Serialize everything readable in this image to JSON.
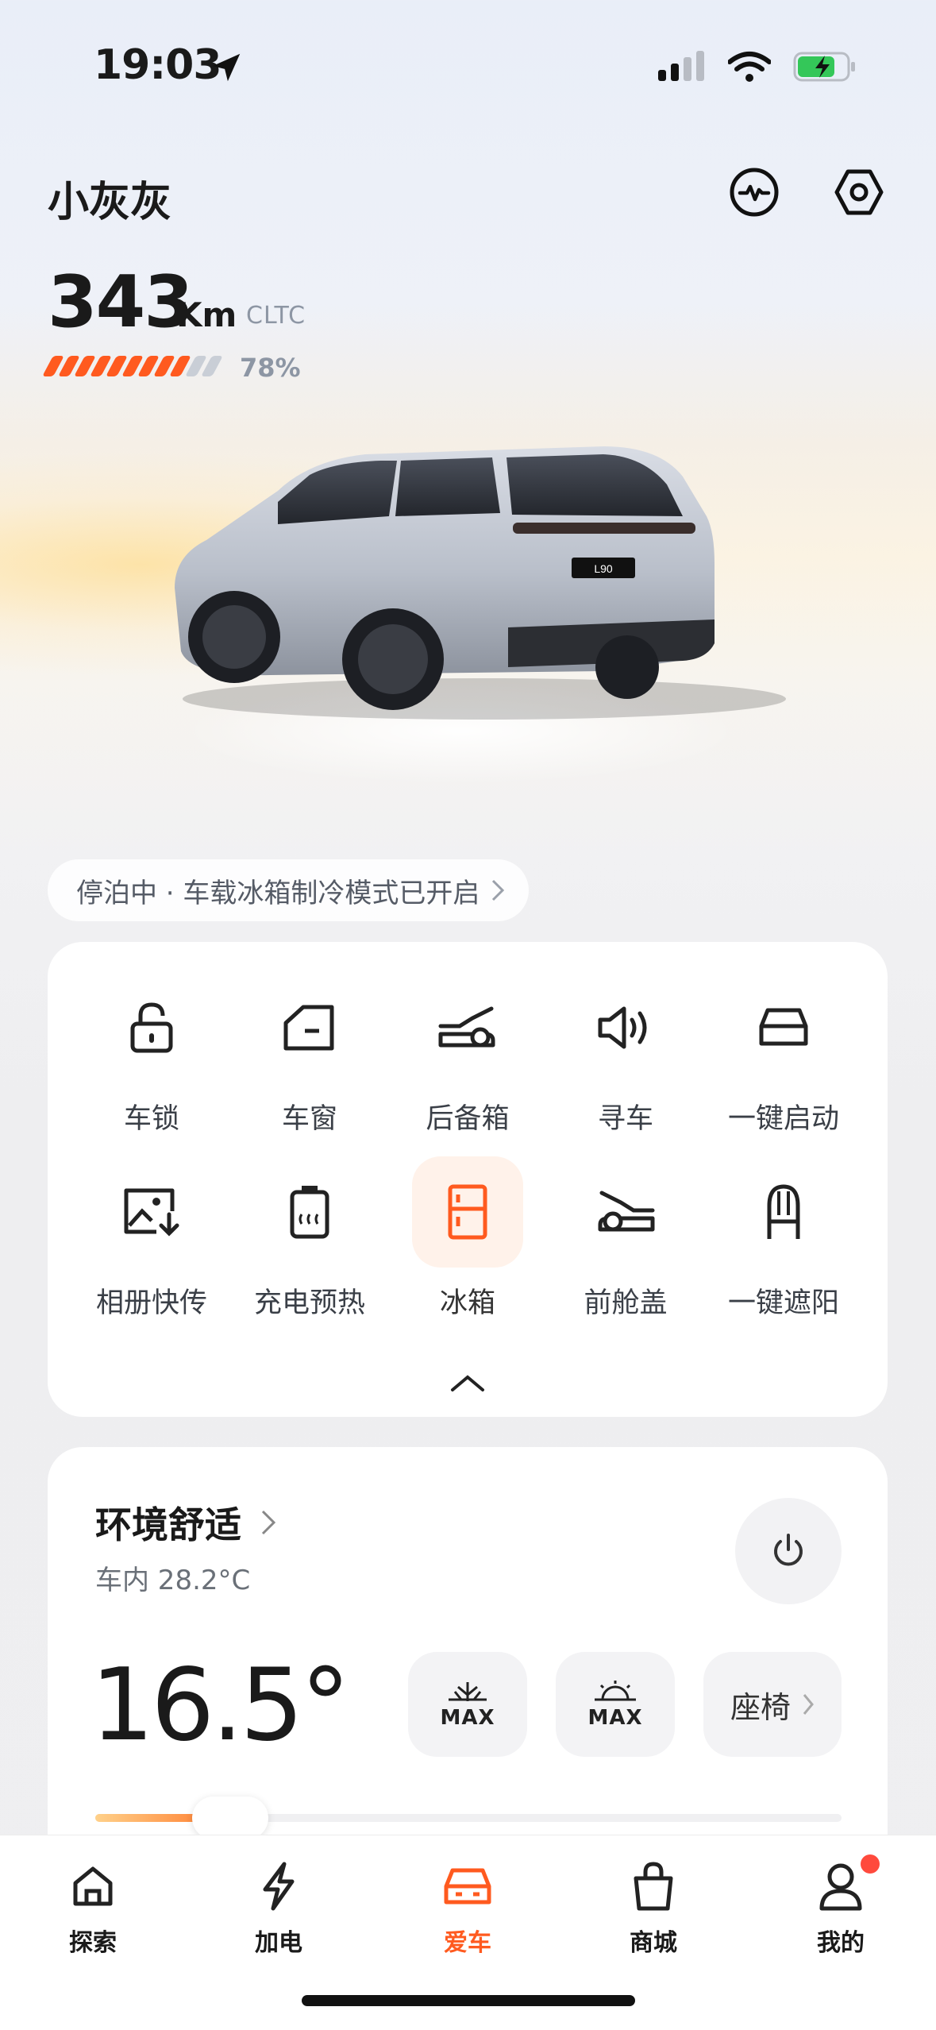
{
  "status_bar": {
    "time": "19:03",
    "battery_charging": true
  },
  "header": {
    "car_name": "小灰灰",
    "icons": [
      "activity-icon",
      "hexagon-settings-icon"
    ]
  },
  "range": {
    "value": "343",
    "unit": "Km",
    "standard": "CLTC",
    "battery_percent_label": "78%",
    "battery_level": 0.78,
    "bar_count": 11
  },
  "vehicle_plate": "L90",
  "notice": {
    "text": "停泊中 · 车载冰箱制冷模式已开启"
  },
  "controls": [
    {
      "label": "车锁",
      "icon": "lock-icon"
    },
    {
      "label": "车窗",
      "icon": "window-icon"
    },
    {
      "label": "后备箱",
      "icon": "trunk-icon"
    },
    {
      "label": "寻车",
      "icon": "speaker-icon"
    },
    {
      "label": "一键启动",
      "icon": "car-start-icon"
    },
    {
      "label": "相册快传",
      "icon": "photo-transfer-icon"
    },
    {
      "label": "充电预热",
      "icon": "battery-heat-icon"
    },
    {
      "label": "冰箱",
      "icon": "fridge-icon",
      "active": true
    },
    {
      "label": "前舱盖",
      "icon": "hood-icon"
    },
    {
      "label": "一键遮阳",
      "icon": "sunshade-icon"
    }
  ],
  "climate": {
    "title": "环境舒适",
    "inside_temp": "车内 28.2°C",
    "set_temp": "16.5°",
    "max_cool_label": "MAX",
    "max_heat_label": "MAX",
    "seat_label": "座椅",
    "temp_level": 0.14
  },
  "tabbar": [
    {
      "label": "探索",
      "icon": "home-icon"
    },
    {
      "label": "加电",
      "icon": "lightning-icon"
    },
    {
      "label": "爱车",
      "icon": "car-icon",
      "active": true
    },
    {
      "label": "商城",
      "icon": "shopping-bag-icon"
    },
    {
      "label": "我的",
      "icon": "person-icon",
      "badge": true
    }
  ],
  "colors": {
    "accent": "#ff5a1f",
    "accent_light": "#fff2ea",
    "muted": "#8d96a4"
  }
}
